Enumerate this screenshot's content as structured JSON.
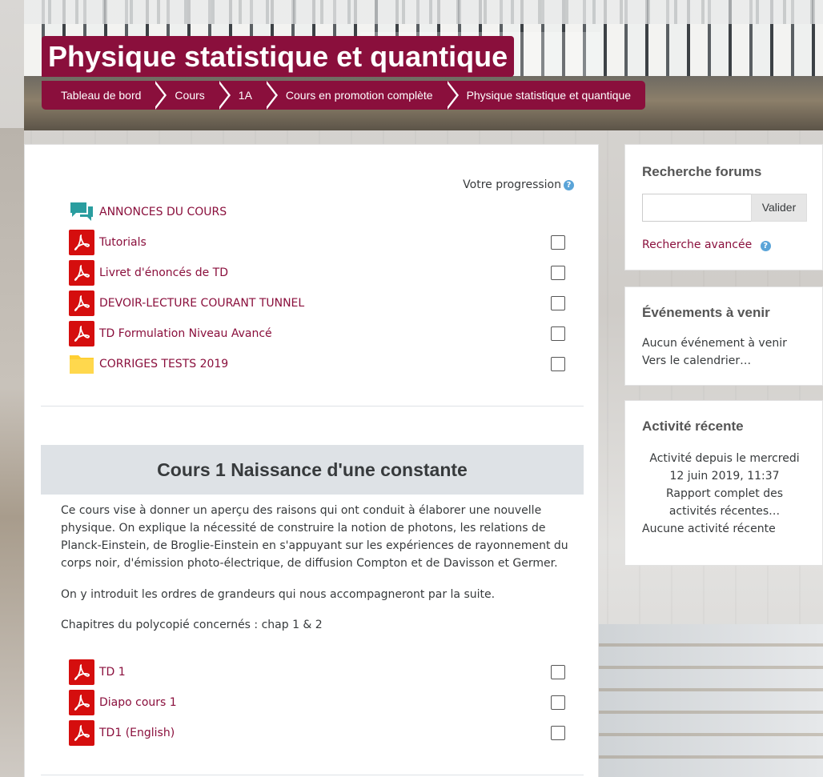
{
  "header": {
    "course_title": "Physique statistique et quantique",
    "breadcrumb": [
      "Tableau de bord",
      "Cours",
      "1A",
      "Cours en promotion complète",
      "Physique statistique et quantique"
    ]
  },
  "main": {
    "progress_label": "Votre progression",
    "top_activities": [
      {
        "label": "ANNONCES DU COURS",
        "icon": "forum-icon",
        "checkbox": false
      },
      {
        "label": "Tutorials",
        "icon": "pdf-icon",
        "checkbox": true
      },
      {
        "label": "Livret d'énoncés de TD",
        "icon": "pdf-icon",
        "checkbox": true
      },
      {
        "label": "DEVOIR-LECTURE COURANT TUNNEL",
        "icon": "pdf-icon",
        "checkbox": true
      },
      {
        "label": "TD Formulation Niveau Avancé",
        "icon": "pdf-icon",
        "checkbox": true
      },
      {
        "label": "CORRIGES TESTS 2019",
        "icon": "folder-icon",
        "checkbox": true
      }
    ],
    "section1": {
      "title": "Cours 1 Naissance d'une constante",
      "paragraph1": "Ce cours vise à donner un aperçu des raisons qui ont conduit à élaborer une nouvelle physique. On explique la nécessité de construire la notion de photons, les relations de Planck-Einstein, de Broglie-Einstein en s'appuyant sur les expériences de rayonnement du corps noir, d'émission photo-électrique, de diffusion Compton et de Davisson et Germer.",
      "paragraph2": "On y introduit les ordres de grandeurs qui nous accompagneront par la suite.",
      "paragraph3": "Chapitres du polycopié concernés : chap 1 & 2",
      "activities": [
        {
          "label": "TD 1",
          "icon": "pdf-icon"
        },
        {
          "label": "Diapo cours 1",
          "icon": "pdf-icon"
        },
        {
          "label": "TD1 (English)",
          "icon": "pdf-icon"
        }
      ]
    }
  },
  "sidebar": {
    "search_forums": {
      "title": "Recherche forums",
      "button": "Valider",
      "advanced_link": "Recherche avancée"
    },
    "upcoming_events": {
      "title": "Événements à venir",
      "none_text": "Aucun événement à venir",
      "calendar_link": "Vers le calendrier…"
    },
    "recent_activity": {
      "title": "Activité récente",
      "since_text": "Activité depuis le mercredi 12 juin 2019, 11:37",
      "report_link": "Rapport complet des activités récentes…",
      "none_text": "Aucune activité récente"
    }
  },
  "colors": {
    "brand": "#8a0f3c",
    "pdf": "#d50e0e",
    "forum": "#2a9d9f",
    "folder": "#ffcf33",
    "section_bg": "#dee2e6"
  }
}
